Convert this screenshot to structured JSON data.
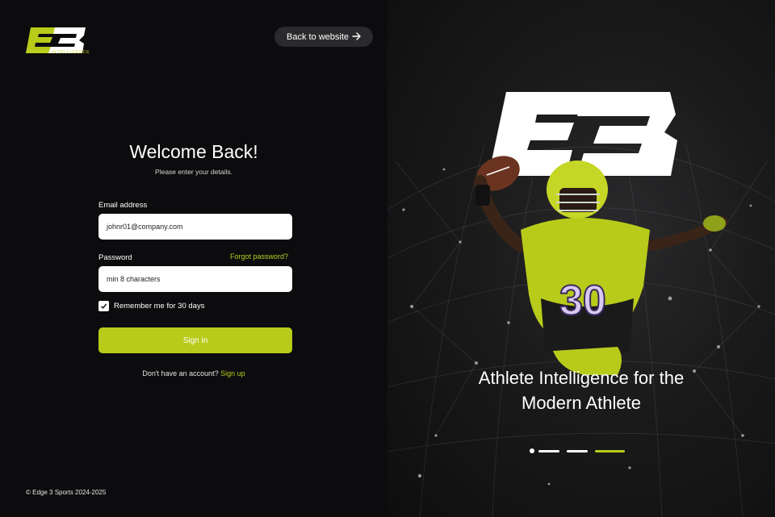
{
  "brand": {
    "logo_text": "E3",
    "tagline": "ATHLETE INTELLIGENCE",
    "accent_color": "#b8cb1a"
  },
  "header": {
    "back_label": "Back to website",
    "back_icon": "arrow-right-icon"
  },
  "form": {
    "title": "Welcome Back!",
    "subtitle": "Please enter your details.",
    "email_label": "Email address",
    "email_value": "johnr01@company.com",
    "password_label": "Password",
    "forgot_label": "Forgot password?",
    "password_placeholder": "min 8 characters",
    "remember_label": "Remember me for 30 days",
    "remember_checked": true,
    "signin_label": "Sign in",
    "no_account_text": "Don't have an account?",
    "signup_label": "Sign up"
  },
  "footer": {
    "copyright": "© Edge 3 Sports 2024-2025"
  },
  "hero": {
    "big_logo_text": "E3",
    "jersey_number": "30",
    "tagline_line1": "Athlete Intelligence for the",
    "tagline_line2": "Modern Athlete",
    "carousel_slides": 4,
    "carousel_active_index": 3
  }
}
